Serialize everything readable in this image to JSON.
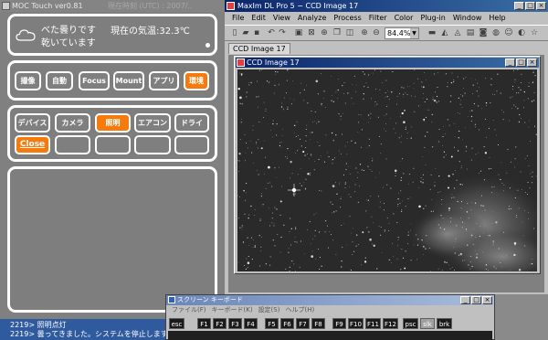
{
  "moc": {
    "title": "MOC Touch ver0.81",
    "title_sub": "現在時刻 (UTC) : 2007/..",
    "status": {
      "weather_line1": "べた曇りです",
      "weather_line2": "乾いています",
      "temperature": "現在の気温:32.3℃"
    },
    "nav": [
      "撮像",
      "自動",
      "Focus",
      "Mount",
      "アプリ",
      "環境"
    ],
    "nav_active_index": 5,
    "devices": [
      "デバイス",
      "カメラ",
      "照明",
      "エアコン",
      "ドライ"
    ],
    "devices_active_index": 2,
    "close_label": "Close",
    "log": [
      "2219> 照明点灯",
      "2219> 曇ってきました。システムを停止します。"
    ],
    "colors": {
      "accent": "#f77b0c",
      "panel_border": "#ffffff",
      "log_bg": "#2f5a9e"
    }
  },
  "maxim": {
    "title": "MaxIm DL Pro 5 − CCD Image 17",
    "menu": [
      "File",
      "Edit",
      "View",
      "Analyze",
      "Process",
      "Filter",
      "Color",
      "Plug-in",
      "Window",
      "Help"
    ],
    "zoom": "84.4%",
    "tab_label": "CCD Image 17",
    "image_window_title": "CCD Image 17"
  },
  "keyboard": {
    "title": "スクリーン キーボード",
    "menu": [
      "ファイル(F)",
      "キーボード(K)",
      "設定(S)",
      "ヘルプ(H)"
    ],
    "keys": [
      "esc",
      "F1",
      "F2",
      "F3",
      "F4",
      "F5",
      "F6",
      "F7",
      "F8",
      "F9",
      "F10",
      "F11",
      "F12",
      "psc",
      "slk",
      "brk"
    ]
  }
}
